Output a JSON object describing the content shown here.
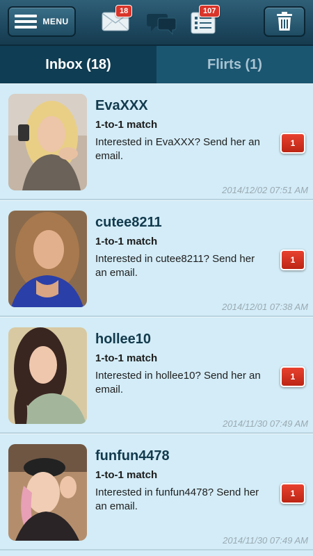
{
  "header": {
    "menu_label": "MENU",
    "mail_badge": "18",
    "list_badge": "107",
    "icons": [
      "hamburger-icon",
      "mail-icon",
      "chat-icon",
      "list-icon",
      "trash-icon"
    ]
  },
  "tabs": [
    {
      "label": "Inbox (18)",
      "active": true
    },
    {
      "label": "Flirts (1)",
      "active": false
    }
  ],
  "messages": [
    {
      "name": "EvaXXX",
      "subtitle": "1-to-1 match",
      "text": "Interested in EvaXXX? Send her an email.",
      "count": "1",
      "timestamp": "2014/12/02 07:51 AM"
    },
    {
      "name": "cutee8211",
      "subtitle": "1-to-1 match",
      "text": "Interested in cutee8211? Send her an email.",
      "count": "1",
      "timestamp": "2014/12/01 07:38 AM"
    },
    {
      "name": "hollee10",
      "subtitle": "1-to-1 match",
      "text": "Interested in hollee10? Send her an email.",
      "count": "1",
      "timestamp": "2014/11/30 07:49 AM"
    },
    {
      "name": "funfun4478",
      "subtitle": "1-to-1 match",
      "text": "Interested in funfun4478? Send her an email.",
      "count": "1",
      "timestamp": "2014/11/30 07:49 AM"
    }
  ],
  "colors": {
    "accent": "#1f4a61",
    "badge": "#d9352a",
    "background": "#d3ecf7"
  }
}
